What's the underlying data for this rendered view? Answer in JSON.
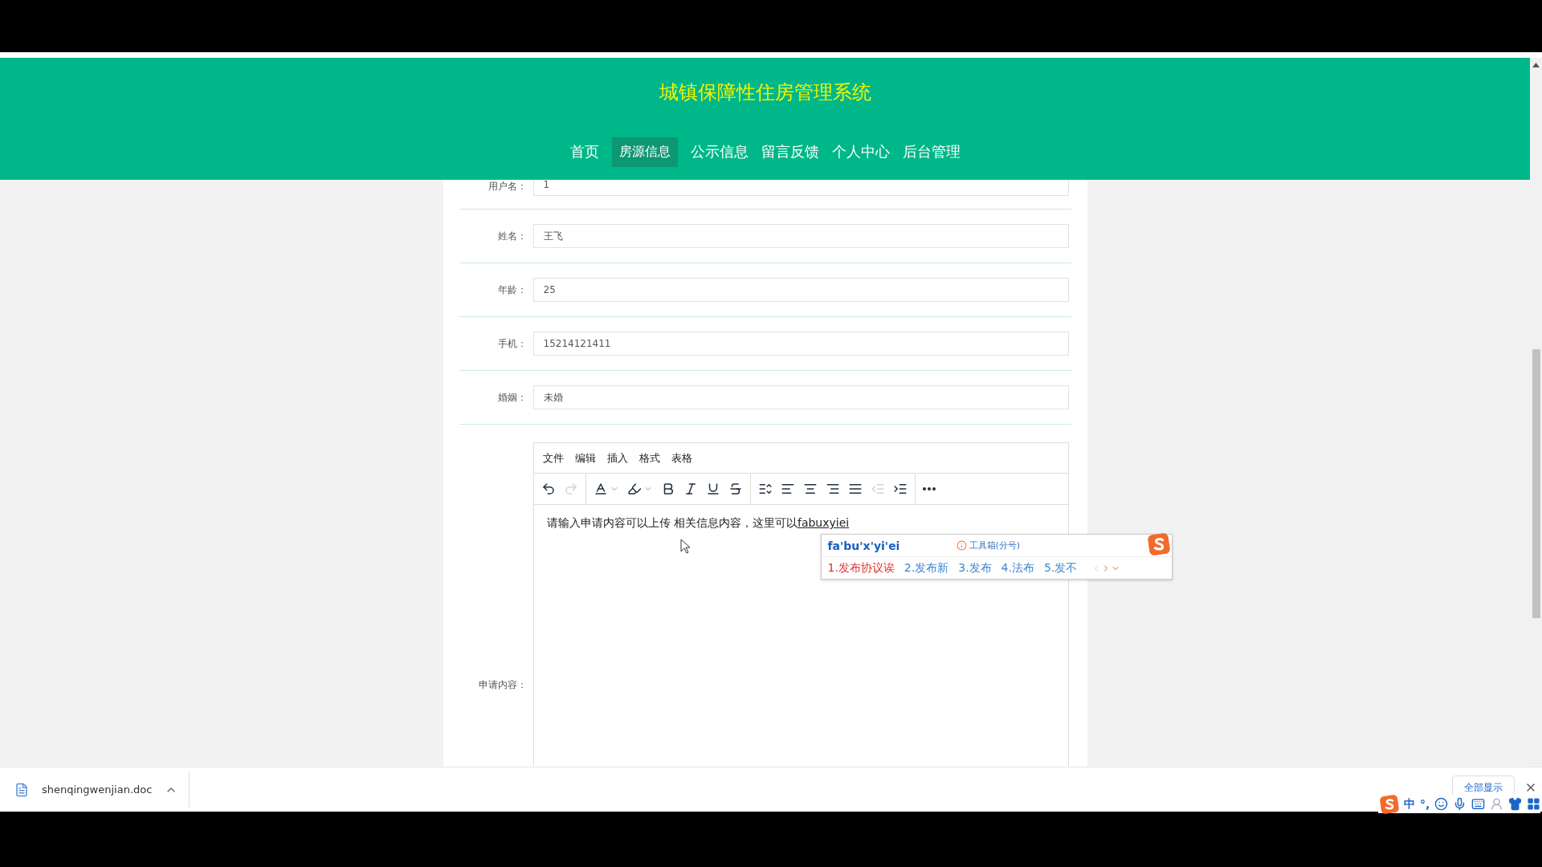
{
  "header": {
    "title": "城镇保障性住房管理系统"
  },
  "nav": [
    {
      "label": "首页",
      "selected": false
    },
    {
      "label": "房源信息",
      "selected": true
    },
    {
      "label": "公示信息",
      "selected": false
    },
    {
      "label": "留言反馈",
      "selected": false
    },
    {
      "label": "个人中心",
      "selected": false
    },
    {
      "label": "后台管理",
      "selected": false
    }
  ],
  "form": {
    "fields": [
      {
        "label": "用户名：",
        "value": "1"
      },
      {
        "label": "姓名：",
        "value": "王飞"
      },
      {
        "label": "年龄：",
        "value": "25"
      },
      {
        "label": "手机：",
        "value": "15214121411"
      },
      {
        "label": "婚姻：",
        "value": "未婚"
      }
    ],
    "editor": {
      "label": "申请内容：",
      "menu": [
        "文件",
        "编辑",
        "插入",
        "格式",
        "表格"
      ],
      "toolbar": [
        {
          "kind": "undo",
          "disabled": false
        },
        {
          "kind": "redo",
          "disabled": true
        },
        {
          "kind": "sep"
        },
        {
          "kind": "text-color",
          "disabled": false
        },
        {
          "kind": "highlight",
          "disabled": false
        },
        {
          "kind": "bold",
          "disabled": false
        },
        {
          "kind": "italic",
          "disabled": false
        },
        {
          "kind": "underline",
          "disabled": false
        },
        {
          "kind": "strike",
          "disabled": false
        },
        {
          "kind": "sep"
        },
        {
          "kind": "line-height",
          "disabled": false
        },
        {
          "kind": "align-left",
          "disabled": false
        },
        {
          "kind": "align-center",
          "disabled": false
        },
        {
          "kind": "align-right",
          "disabled": false
        },
        {
          "kind": "justify",
          "disabled": false
        },
        {
          "kind": "outdent",
          "disabled": true
        },
        {
          "kind": "indent",
          "disabled": false
        },
        {
          "kind": "sep"
        },
        {
          "kind": "more",
          "disabled": false
        }
      ],
      "text": "请输入申请内容可以上传 相关信息内容，这里可以",
      "composition": "fabuxyiei"
    }
  },
  "ime": {
    "input": "fa'bu'x'yi'ei",
    "toolbox": "工具箱(分号)",
    "candidates": [
      {
        "label": "1.发布协议诶",
        "selected": true
      },
      {
        "label": "2.发布新",
        "selected": false
      },
      {
        "label": "3.发布",
        "selected": false
      },
      {
        "label": "4.法布",
        "selected": false
      },
      {
        "label": "5.发不",
        "selected": false
      }
    ]
  },
  "downloads": {
    "file": "shenqingwenjian.doc",
    "show_all": "全部显示"
  },
  "ime_tray": {
    "items": [
      "中",
      "°,"
    ]
  }
}
